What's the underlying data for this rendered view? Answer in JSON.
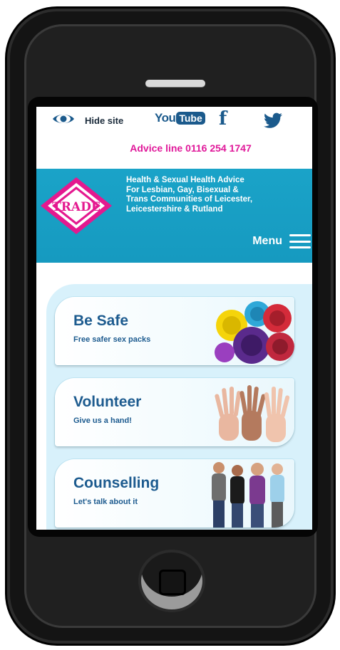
{
  "topbar": {
    "hide_site_label": "Hide site",
    "youtube_you": "You",
    "youtube_tube": "Tube",
    "facebook_glyph": "f",
    "advice_line": "Advice line 0116 254 1747"
  },
  "header": {
    "logo_text": "TRADE",
    "tagline_lines": [
      "Health & Sexual Health Advice",
      "For Lesbian, Gay, Bisexual &",
      "Trans Communities of Leicester,",
      "Leicestershire & Rutland"
    ],
    "menu_label": "Menu"
  },
  "cards": [
    {
      "title": "Be Safe",
      "subtitle": "Free safer sex packs",
      "image": "condoms-photo"
    },
    {
      "title": "Volunteer",
      "subtitle": "Give us a hand!",
      "image": "raised-hands-photo"
    },
    {
      "title": "Counselling",
      "subtitle": "Let's talk about it",
      "image": "group-of-people-photo"
    }
  ],
  "colors": {
    "accent_blue": "#1aa3c8",
    "brand_pink": "#e0199a",
    "text_blue": "#1d5b8f",
    "card_bg": "#d8f1fb"
  },
  "icons": [
    "eye-icon",
    "youtube-icon",
    "facebook-icon",
    "twitter-icon",
    "hamburger-icon"
  ]
}
